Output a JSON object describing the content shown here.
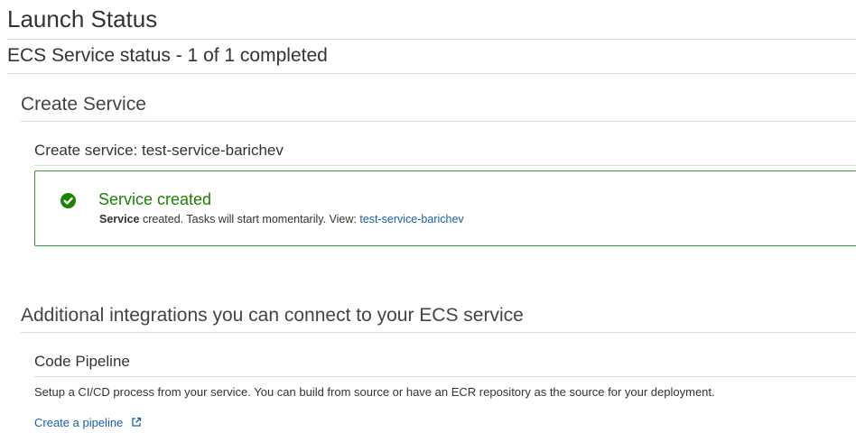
{
  "page": {
    "title": "Launch Status",
    "subtitle": "ECS Service status - 1 of 1 completed"
  },
  "create_service": {
    "section_title": "Create Service",
    "sub_title": "Create service: test-service-barichev",
    "alert": {
      "icon": "check-circle-icon",
      "status_color": "#1d8102",
      "title": "Service created",
      "bold_word": "Service",
      "message_mid": "created. Tasks will start momentarily. View:",
      "link_text": "test-service-barichev"
    }
  },
  "integrations": {
    "section_title": "Additional integrations you can connect to your ECS service",
    "code_pipeline": {
      "title": "Code Pipeline",
      "description": "Setup a CI/CD process from your service. You can build from source or have an ECR repository as the source for your deployment.",
      "link_text": "Create a pipeline",
      "link_icon": "external-link-icon"
    }
  }
}
